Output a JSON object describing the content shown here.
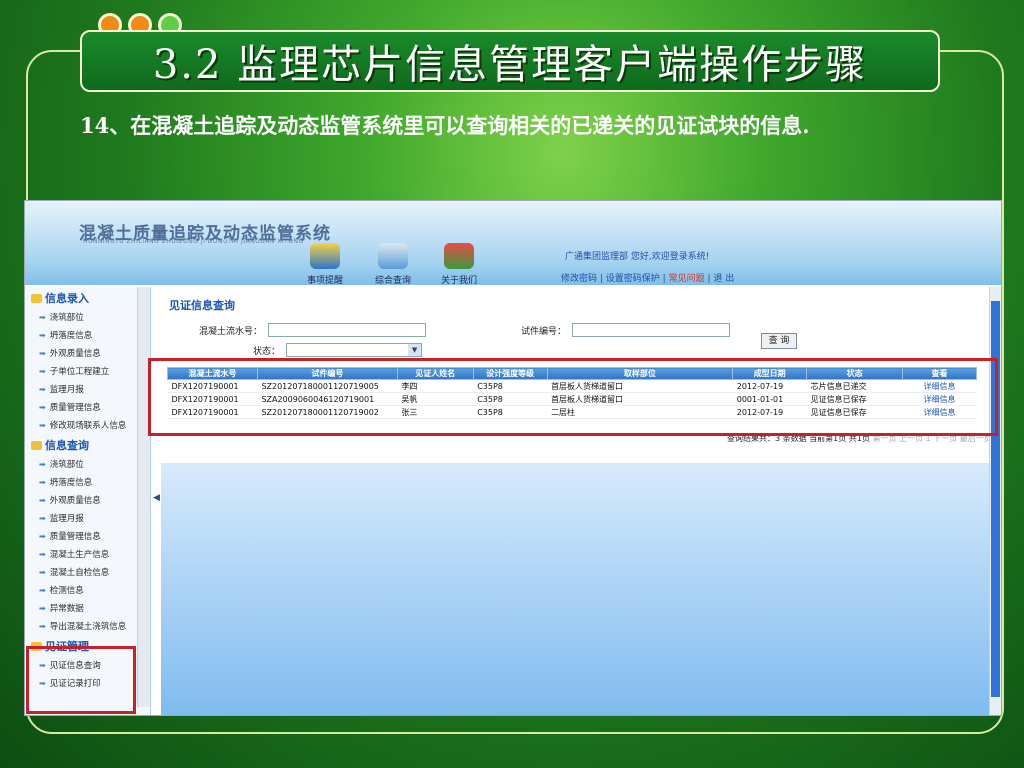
{
  "slide": {
    "title": "3.2 监理芯片信息管理客户端操作步骤",
    "step_text": "14、在混凝土追踪及动态监管系统里可以查询相关的已递关的见证试块的信息."
  },
  "app": {
    "logo": "混凝土质量追踪及动态监管系统",
    "logo_sub": "HUNNINGTU ZHILIANG ZHUIZONG JI DONGTAI JIANGUAN XITONG",
    "nav": [
      {
        "label": "事项提醒",
        "icon": "bell-icon"
      },
      {
        "label": "综合查询",
        "icon": "magnifier-icon"
      },
      {
        "label": "关于我们",
        "icon": "people-icon"
      }
    ],
    "user_line": "广通集团监理部 您好,欢迎登录系统!",
    "user_links": [
      "修改密码",
      "设置密码保护",
      "常见问题",
      "退 出"
    ]
  },
  "sidebar": {
    "sections": [
      {
        "title": "信息录入",
        "items": [
          "浇筑部位",
          "坍落度信息",
          "外观质量信息",
          "子单位工程建立",
          "监理月报",
          "质量管理信息",
          "修改现场联系人信息"
        ]
      },
      {
        "title": "信息查询",
        "items": [
          "浇筑部位",
          "坍落度信息",
          "外观质量信息",
          "监理月报",
          "质量管理信息",
          "混凝土生产信息",
          "混凝土自检信息",
          "检测信息",
          "异常数据",
          "导出混凝土浇筑信息"
        ]
      },
      {
        "title": "见证管理",
        "items": [
          "见证信息查询",
          "见证记录打印"
        ]
      }
    ]
  },
  "panel": {
    "title": "见证信息查询",
    "label_flow": "混凝土流水号：",
    "label_specimen": "试件编号：",
    "label_status": "状态：",
    "query_button": "查 询",
    "columns": [
      "混凝土流水号",
      "试件编号",
      "见证人姓名",
      "设计强度等级",
      "取样部位",
      "成型日期",
      "状态",
      "查看"
    ],
    "rows": [
      [
        "DFX1207190001",
        "SZ20120718000112071900​5",
        "李四",
        "C35P8",
        "首层板人货梯道留口",
        "2012-07-19",
        "芯片信息已递交",
        "详细信息"
      ],
      [
        "DFX1207190001",
        "SZA2009060046120719001",
        "吴帆",
        "C35P8",
        "首层板人货梯道留口",
        "0001-01-01",
        "见证信息已保存",
        "详细信息"
      ],
      [
        "DFX1207190001",
        "SZ2012071800011207190​02",
        "张三",
        "C35P8",
        "二层柱",
        "2012-07-19",
        "见证信息已保存",
        "详细信息"
      ]
    ],
    "pager": "查询结果共：3 条数据 当前第1页 共1页",
    "pager_links": "第一页 上一页 1 下一页 最后一页"
  }
}
